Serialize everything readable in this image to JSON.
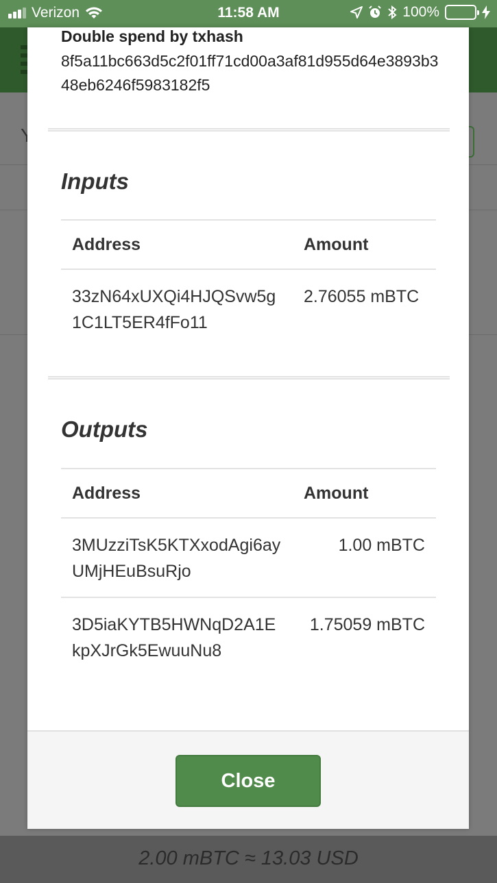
{
  "status_bar": {
    "carrier": "Verizon",
    "time": "11:58 AM",
    "battery": "100%"
  },
  "modal": {
    "double_spend_label": "Double spend by txhash",
    "double_spend_hash": "8f5a11bc663d5c2f01ff71cd00a3af81d955d64e3893b348eb6246f5983182f5",
    "inputs": {
      "title": "Inputs",
      "col_address": "Address",
      "col_amount": "Amount",
      "rows": [
        {
          "address": "33zN64xUXQi4HJQSvw5g1C1LT5ER4fFo11",
          "amount": "2.76055 mBTC"
        }
      ]
    },
    "outputs": {
      "title": "Outputs",
      "col_address": "Address",
      "col_amount": "Amount",
      "rows": [
        {
          "address": "3MUzziTsK5KTXxodAgi6ayUMjHEuBsuRjo",
          "amount": "1.00 mBTC"
        },
        {
          "address": "3D5iaKYTB5HWNqD2A1EkpXJrGk5EwuuNu8",
          "amount": "1.75059 mBTC"
        }
      ]
    },
    "close_label": "Close"
  },
  "background": {
    "partial_letter": "Y",
    "footer_balance": "2.00 mBTC ≈ 13.03 USD"
  },
  "colors": {
    "status_bar": "#5e8f58",
    "accent_green": "#518b4b",
    "header_dim": "#2f5a2c"
  }
}
